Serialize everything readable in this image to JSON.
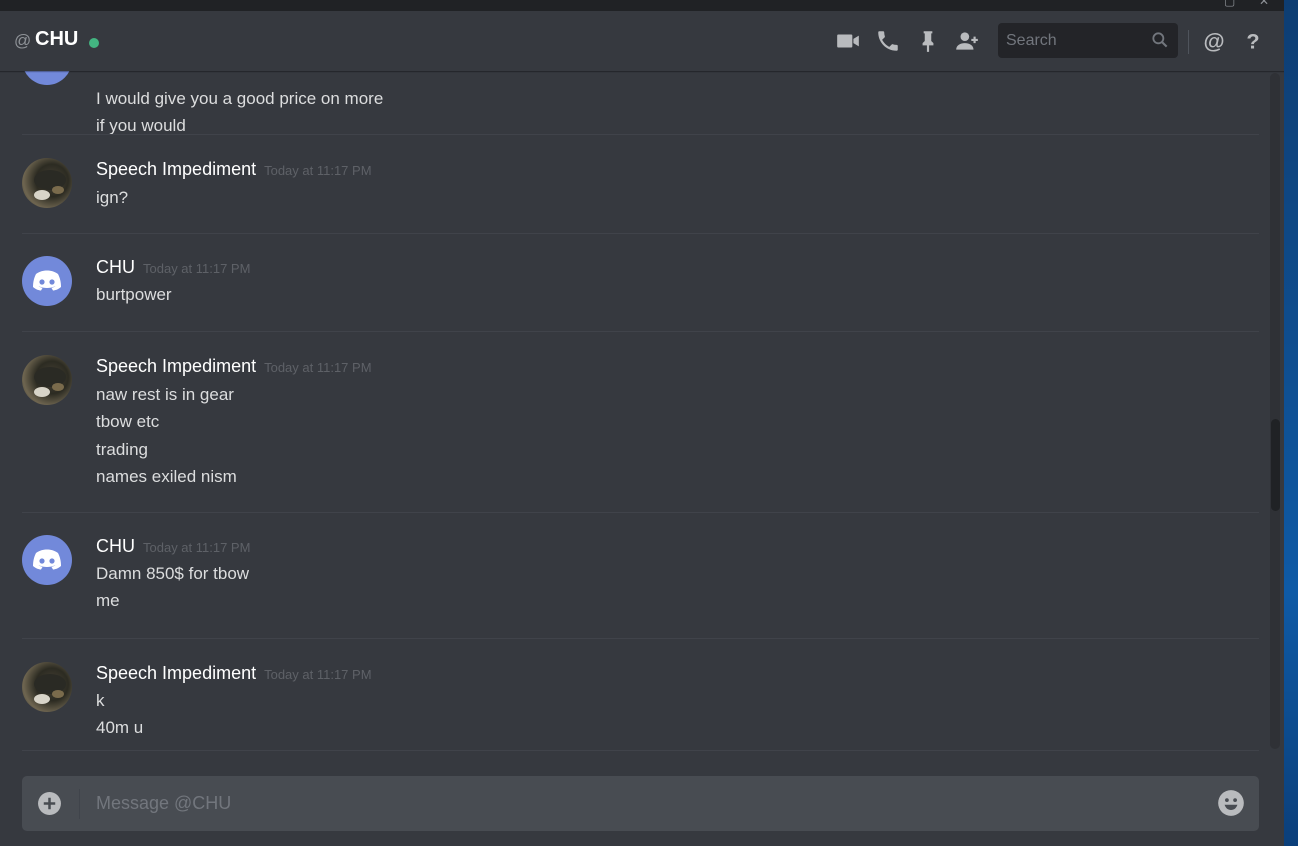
{
  "header": {
    "at_symbol": "@",
    "channel_name": "CHU",
    "status_color": "#43b581",
    "icons": [
      "video-call-icon",
      "voice-call-icon",
      "pin-icon",
      "add-friend-icon",
      "mention-icon",
      "help-icon"
    ],
    "search_placeholder": "Search"
  },
  "messages": [
    {
      "author": "",
      "timestamp": "",
      "avatar": "discord",
      "lines": [
        "I would give you a good price on more",
        "if you would"
      ]
    },
    {
      "author": "Speech Impediment",
      "timestamp": "Today at 11:17 PM",
      "avatar": "photo",
      "lines": [
        "ign?"
      ]
    },
    {
      "author": "CHU",
      "timestamp": "Today at 11:17 PM",
      "avatar": "discord",
      "lines": [
        "burtpower"
      ]
    },
    {
      "author": "Speech Impediment",
      "timestamp": "Today at 11:17 PM",
      "avatar": "photo",
      "lines": [
        "naw rest is in gear",
        "tbow etc",
        "trading",
        "names exiled nism"
      ]
    },
    {
      "author": "CHU",
      "timestamp": "Today at 11:17 PM",
      "avatar": "discord",
      "lines": [
        "Damn 850$ for tbow",
        "me"
      ]
    },
    {
      "author": "Speech Impediment",
      "timestamp": "Today at 11:17 PM",
      "avatar": "photo",
      "lines": [
        "k",
        "40m u"
      ]
    }
  ],
  "composer": {
    "placeholder": "Message @CHU"
  },
  "colors": {
    "background": "#36393f",
    "accent": "#7289da",
    "online": "#43b581"
  }
}
